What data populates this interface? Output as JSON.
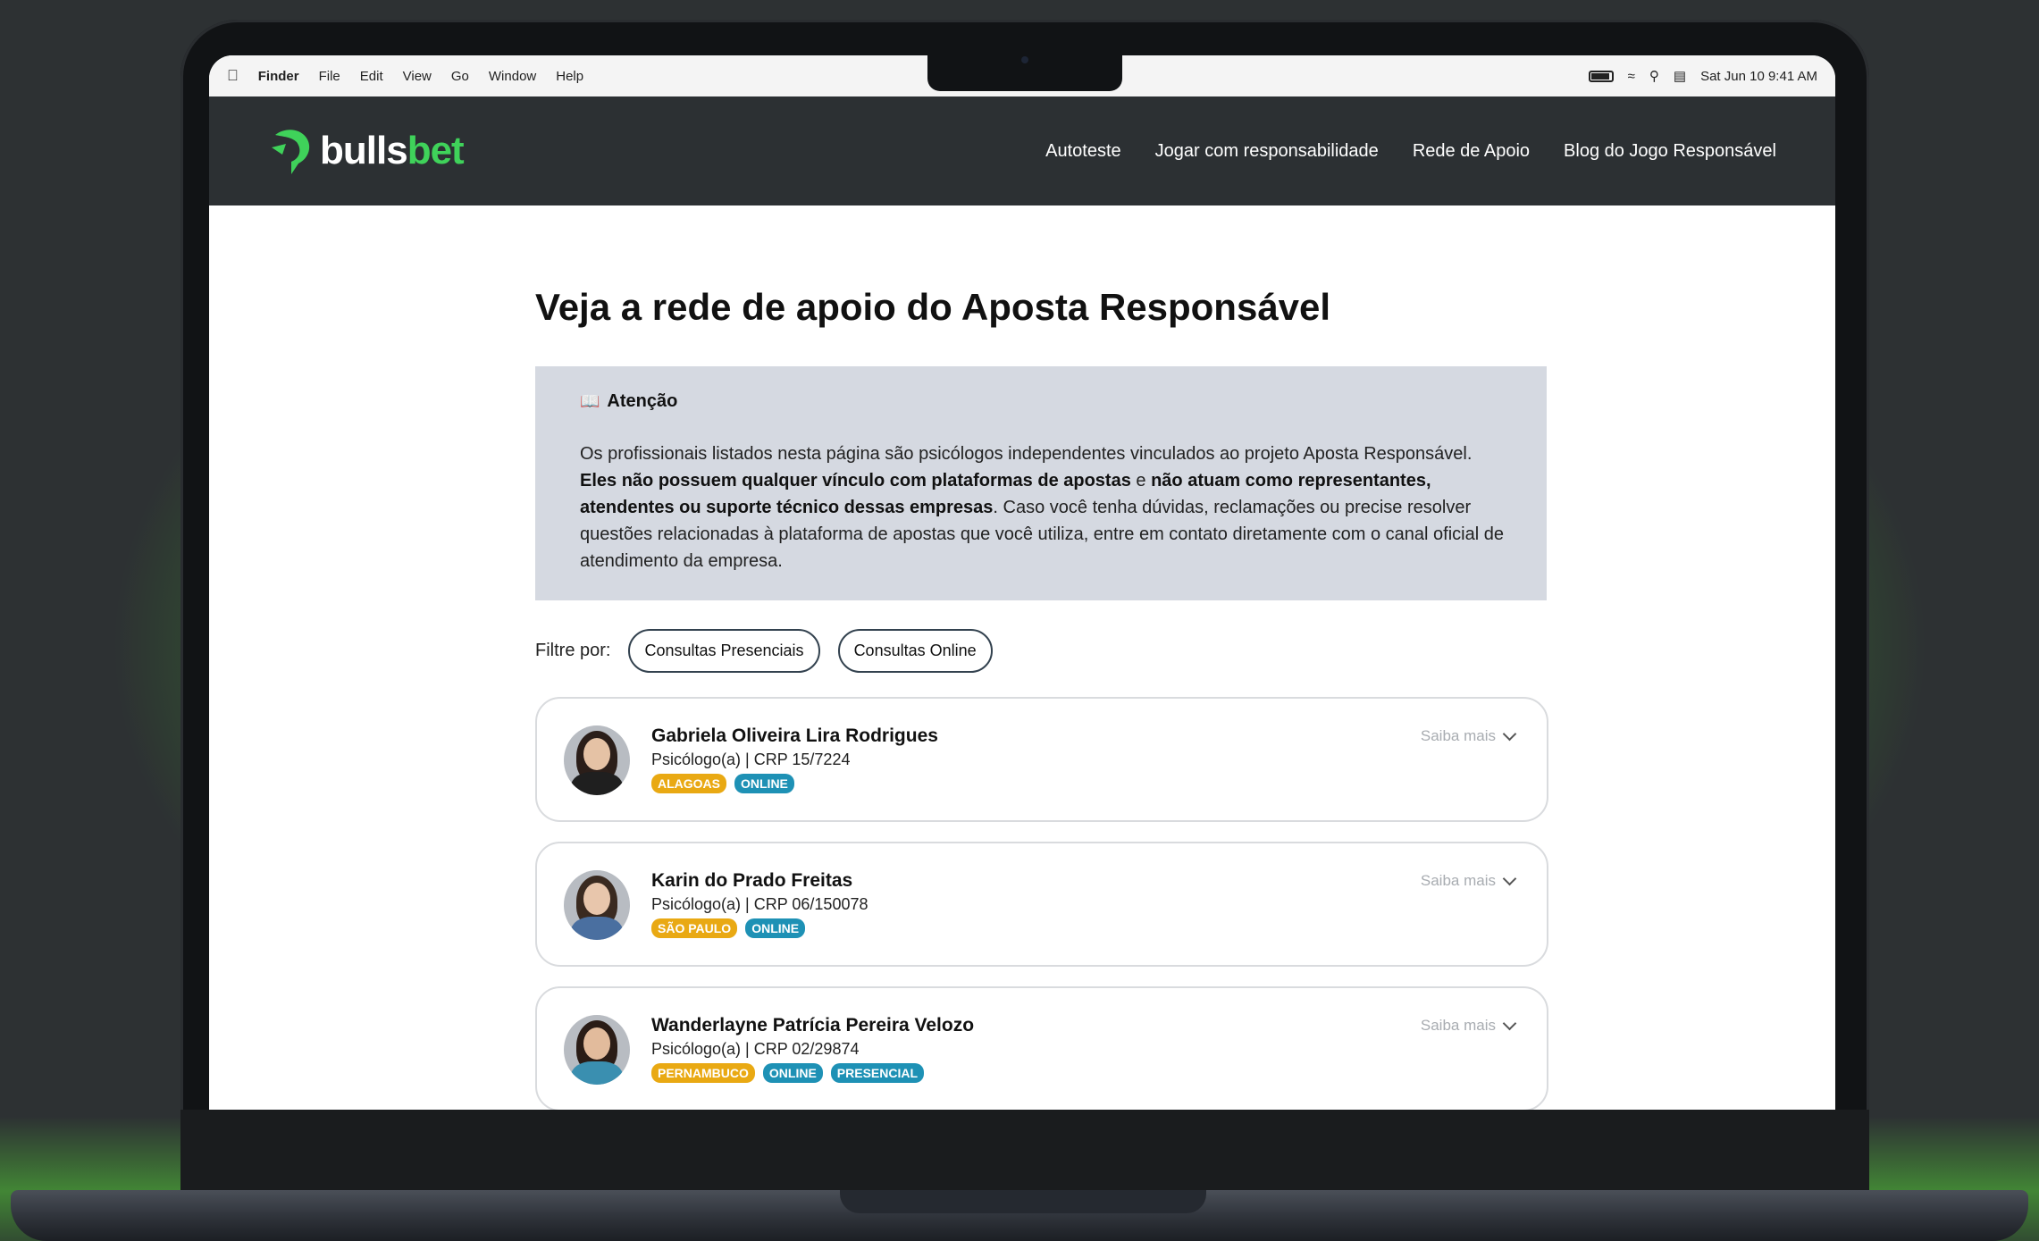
{
  "menubar": {
    "app": "Finder",
    "items": [
      "File",
      "Edit",
      "View",
      "Go",
      "Window",
      "Help"
    ],
    "datetime": "Sat Jun 10  9:41 AM"
  },
  "header": {
    "logo_part1": "bulls",
    "logo_part2": "bet",
    "nav": [
      "Autoteste",
      "Jogar com responsabilidade",
      "Rede de Apoio",
      "Blog do Jogo Responsável"
    ]
  },
  "page": {
    "title": "Veja a rede de apoio do Aposta Responsável"
  },
  "notice": {
    "title": "Atenção",
    "text_part1": "Os profissionais listados nesta página são psicólogos independentes vinculados ao projeto Aposta Responsável.",
    "bold1": "Eles não possuem qualquer vínculo com plataformas de apostas",
    "text_part2": " e ",
    "bold2": "não atuam como representantes, atendentes ou suporte técnico dessas empresas",
    "text_part3": ". Caso você tenha dúvidas, reclamações ou precise resolver questões relacionadas à plataforma de apostas que você utiliza, entre em contato diretamente com o canal oficial de atendimento da empresa."
  },
  "filter": {
    "label": "Filtre por:",
    "options": [
      "Consultas Presenciais",
      "Consultas Online"
    ]
  },
  "professionals": [
    {
      "name": "Gabriela Oliveira Lira Rodrigues",
      "crp": "Psicólogo(a) | CRP 15/7224",
      "state": "ALAGOAS",
      "modes": [
        "ONLINE"
      ],
      "more": "Saiba mais"
    },
    {
      "name": "Karin do Prado Freitas",
      "crp": "Psicólogo(a) | CRP 06/150078",
      "state": "SÃO PAULO",
      "modes": [
        "ONLINE"
      ],
      "more": "Saiba mais"
    },
    {
      "name": "Wanderlayne Patrícia Pereira Velozo",
      "crp": "Psicólogo(a) | CRP 02/29874",
      "state": "PERNAMBUCO",
      "modes": [
        "ONLINE",
        "PRESENCIAL"
      ],
      "more": "Saiba mais"
    }
  ],
  "colors": {
    "brand_green": "#3fd25a",
    "header_bg": "#2c3033",
    "state_tag": "#e9a913",
    "mode_tag": "#1e91b5",
    "notice_bg": "#d5d9e1"
  }
}
